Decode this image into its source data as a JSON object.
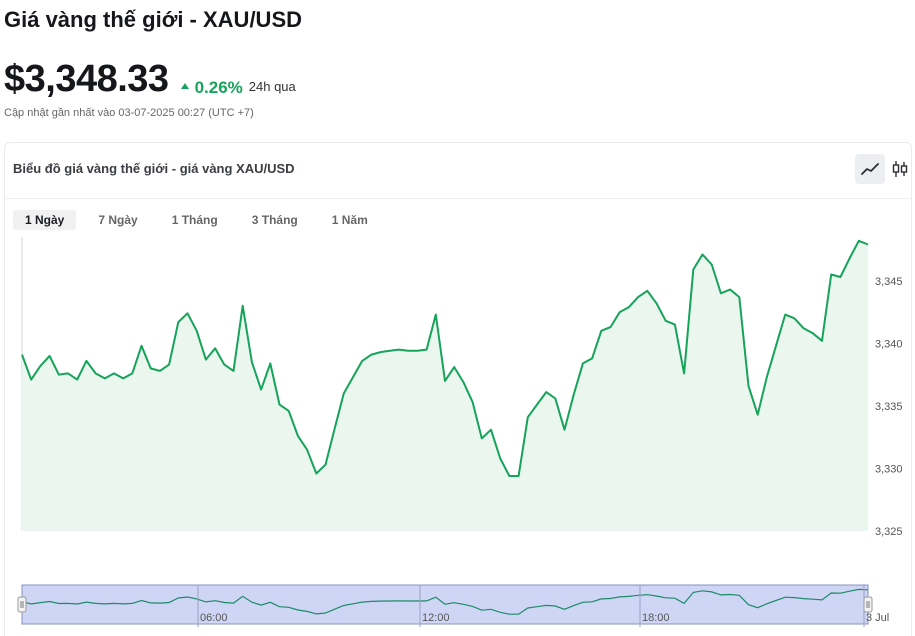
{
  "header": {
    "title": "Giá vàng thế giới - XAU/USD",
    "price": "$3,348.33",
    "change": "0.26%",
    "period": "24h qua",
    "updated": "Cập nhật gần nhất vào 03-07-2025 00:27 (UTC +7)"
  },
  "card": {
    "title": "Biểu đồ giá vàng thế giới - giá vàng XAU/USD",
    "tabs": [
      {
        "label": "1 Ngày",
        "active": true
      },
      {
        "label": "7 Ngày",
        "active": false
      },
      {
        "label": "1 Tháng",
        "active": false
      },
      {
        "label": "3 Tháng",
        "active": false
      },
      {
        "label": "1 Năm",
        "active": false
      }
    ],
    "chart_types": [
      {
        "icon": "line-chart-icon",
        "active": true
      },
      {
        "icon": "candlestick-icon",
        "active": false
      }
    ]
  },
  "colors": {
    "line": "#16a35a",
    "area": "#eaf6ee",
    "accent": "#16a35a",
    "navigator_fill": "#cfd6f5",
    "navigator_border": "#8a93c6"
  },
  "chart_data": {
    "type": "line",
    "title": "",
    "xlabel": "",
    "ylabel": "",
    "ylim": [
      3325,
      3348.5
    ],
    "yticks": [
      3325,
      3330,
      3335,
      3340,
      3345
    ],
    "ytick_labels": [
      "3,325",
      "3,330",
      "3,335",
      "3,340",
      "3,345"
    ],
    "navigator_ticks": [
      "06:00",
      "12:00",
      "18:00",
      "3 Jul"
    ],
    "series": [
      {
        "values": [
          3339.1,
          3337.1,
          3338.2,
          3339.0,
          3337.5,
          3337.6,
          3337.1,
          3338.6,
          3337.6,
          3337.2,
          3337.6,
          3337.2,
          3337.6,
          3339.8,
          3338.0,
          3337.8,
          3338.3,
          3341.7,
          3342.4,
          3341.0,
          3338.7,
          3339.6,
          3338.3,
          3337.8,
          3343.0,
          3338.5,
          3336.3,
          3338.4,
          3335.1,
          3334.6,
          3332.6,
          3331.5,
          3329.6,
          3330.3,
          3333.2,
          3336.0,
          3337.3,
          3338.6,
          3339.1,
          3339.3,
          3339.4,
          3339.5,
          3339.4,
          3339.4,
          3339.5,
          3342.3,
          3337.0,
          3338.1,
          3336.9,
          3335.3,
          3332.4,
          3333.1,
          3330.8,
          3329.4,
          3329.4,
          3334.1,
          3335.1,
          3336.1,
          3335.6,
          3333.1,
          3335.9,
          3338.4,
          3338.8,
          3341.0,
          3341.3,
          3342.5,
          3342.9,
          3343.7,
          3344.2,
          3343.2,
          3341.8,
          3341.5,
          3337.6,
          3345.9,
          3347.1,
          3346.3,
          3344.0,
          3344.3,
          3343.7,
          3336.6,
          3334.3,
          3337.3,
          3339.8,
          3342.3,
          3342.0,
          3341.2,
          3340.8,
          3340.2,
          3345.5,
          3345.3,
          3346.8,
          3348.2,
          3347.9
        ]
      }
    ]
  }
}
